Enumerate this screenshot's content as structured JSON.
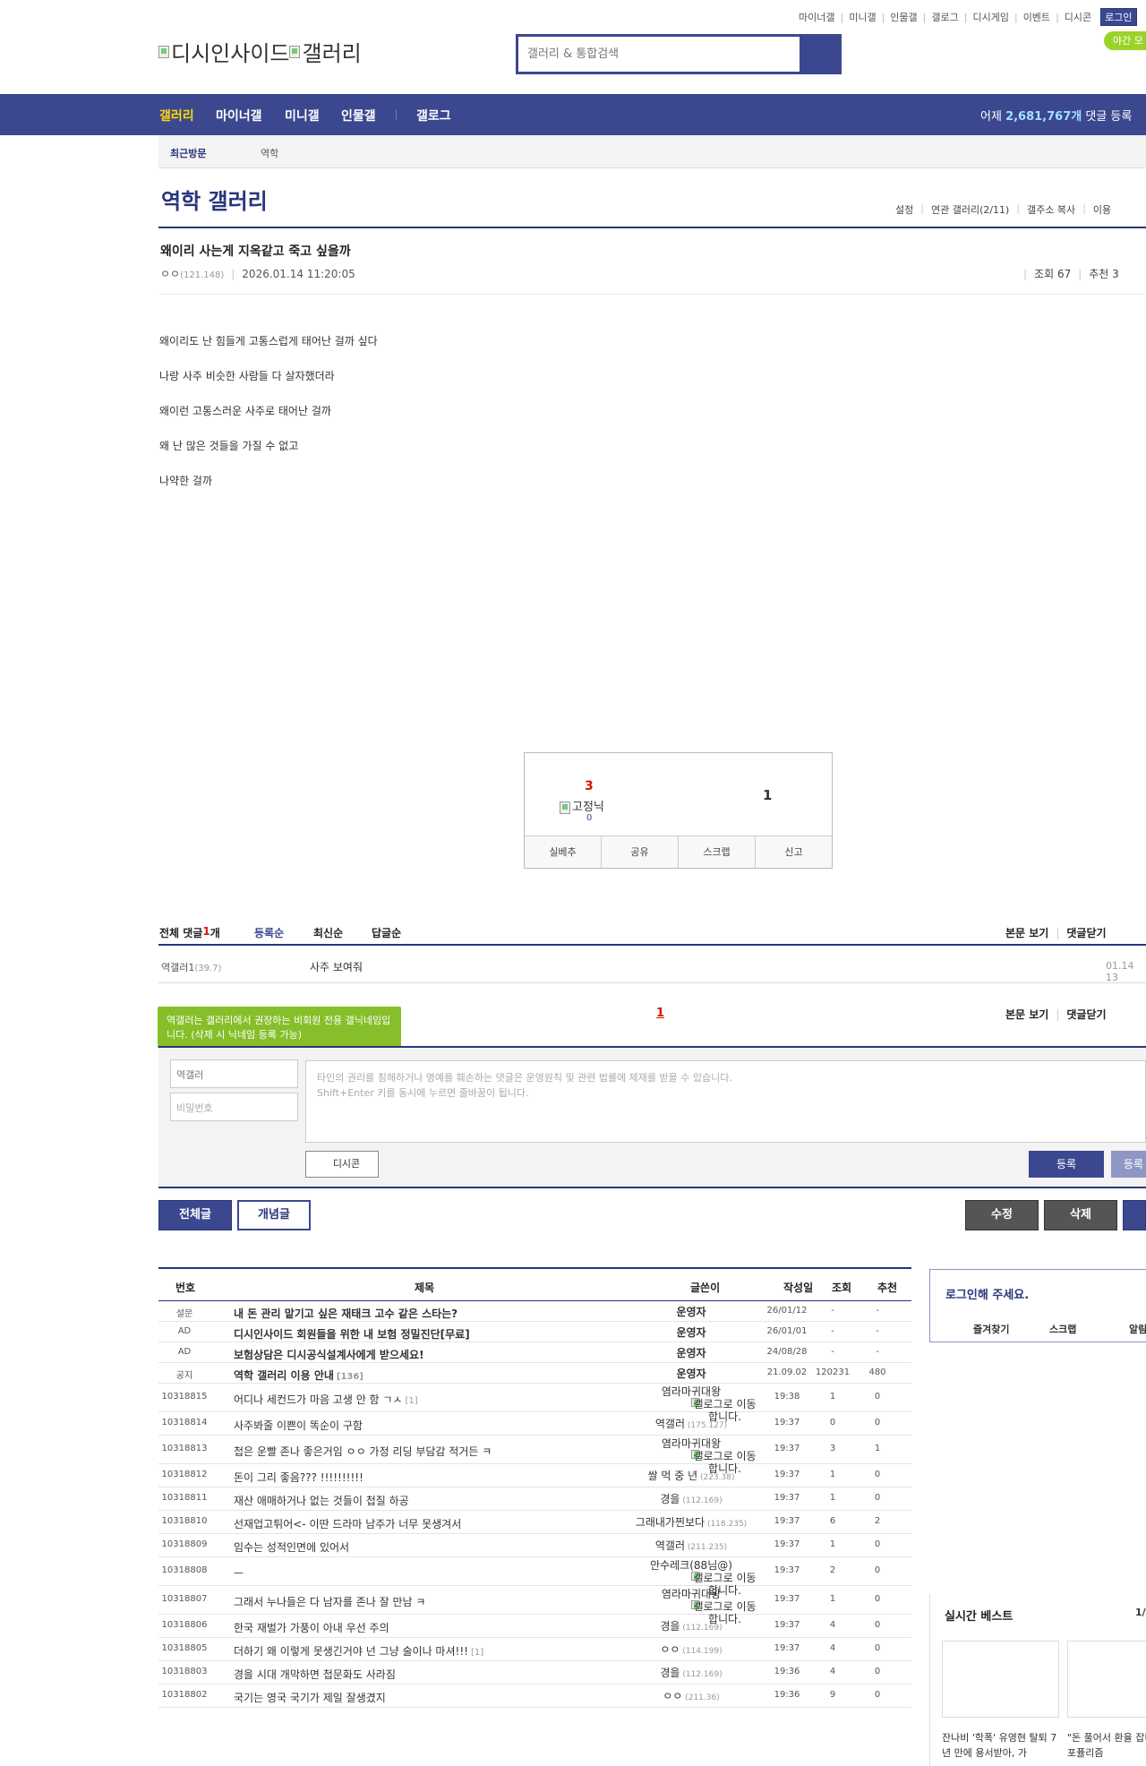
{
  "top_links": [
    "마이너갤",
    "미니갤",
    "인물갤",
    "갤로그",
    "디시게임",
    "이벤트",
    "디시콘"
  ],
  "login_label": "로그인",
  "night_label": "야간 모",
  "logo": {
    "text1": "디시인사이드",
    "text2": "갤러리"
  },
  "search": {
    "placeholder": "갤러리 & 통합검색"
  },
  "nav": {
    "items": [
      "갤러리",
      "마이너갤",
      "미니갤",
      "인물갤",
      "갤로그"
    ],
    "right_prefix": "어제 ",
    "right_count": "2,681,767개",
    "right_suffix": " 댓글 등록"
  },
  "recent": {
    "label": "최근방문",
    "item": "역학"
  },
  "gallery_title": "역학 갤러리",
  "gallery_tools": [
    "설정",
    "연관 갤러리(2/11)",
    "갤주소 복사",
    "이용"
  ],
  "post": {
    "title": "왜이리 사는게 지옥같고 죽고 싶을까",
    "author": "ㅇㅇ",
    "author_ip": "(121.148)",
    "date": "2026.01.14 11:20:05",
    "views_label": "조회 67",
    "recommend_label": "추천 3",
    "body": [
      "왜이리도 난 힘들게 고통스럽게 태어난 걸까 싶다",
      "나랑 사주 비슷한 사람들 다 살자했더라",
      "왜이런 고통스러운 사주로 태어난 걸까",
      "왜 난 많은 것들을 가질 수 없고",
      "나약한 걸까"
    ]
  },
  "recommend_box": {
    "up": "3",
    "fix_label": "고정닉",
    "fix_count": "0",
    "down": "1",
    "buttons": [
      "실베추",
      "공유",
      "스크랩",
      "신고"
    ]
  },
  "comments": {
    "total_label": "전체 댓글 ",
    "total_count": "1",
    "total_unit": "개",
    "sort": [
      "등록순",
      "최신순",
      "답글순"
    ],
    "right_links": [
      "본문 보기",
      "댓글닫기"
    ],
    "items": [
      {
        "author": "역갤러1",
        "ip": "(39.7)",
        "text": "사주 보여줘",
        "date": "01.14 13"
      }
    ],
    "page": "1",
    "tooltip": "역갤러는 갤러리에서 권장하는 비회원 전용 갤닉네임입니다. (삭제 시 닉네임 등록 가능)",
    "form": {
      "nickname": "역갤러",
      "password_placeholder": "비밀번호",
      "textarea_placeholder_1": "타인의 권리를 침해하거나 명예를 훼손하는 댓글은 운영원칙 및 관련 법률에 제재를 받을 수 있습니다.",
      "textarea_placeholder_2": "Shift+Enter 키를 동시에 누르면 줄바꿈이 됩니다.",
      "dccon_label": "디시콘",
      "submit_label": "등록",
      "submit2_label": "등록"
    }
  },
  "list_buttons": {
    "all": "전체글",
    "concept": "개념글",
    "edit": "수정",
    "delete": "삭제"
  },
  "list": {
    "headers": {
      "no": "번호",
      "title": "제목",
      "writer": "글쓴이",
      "date": "작성일",
      "views": "조회",
      "rec": "추천"
    },
    "rows": [
      {
        "no": "설문",
        "title": "내 돈 관리 맡기고 싶은 재태크 고수 같은 스타는?",
        "writer": "운영자",
        "ip": "",
        "date": "26/01/12",
        "views": "-",
        "rec": "-",
        "notice": true
      },
      {
        "no": "AD",
        "title": "디시인사이드 회원들을 위한 내 보험 정밀진단[무료]",
        "writer": "운영자",
        "ip": "",
        "date": "26/01/01",
        "views": "-",
        "rec": "-",
        "notice": true
      },
      {
        "no": "AD",
        "title": "보험상담은 디시공식설계사에게 받으세요!",
        "writer": "운영자",
        "ip": "",
        "date": "24/08/28",
        "views": "-",
        "rec": "-",
        "notice": true
      },
      {
        "no": "공지",
        "title": "역학 갤러리 이용 안내",
        "cnt": "[136]",
        "writer": "운영자",
        "ip": "",
        "date": "21.09.02",
        "views": "120231",
        "rec": "480",
        "notice": true
      },
      {
        "no": "10318815",
        "title": "어디나 세컨드가 마음 고생 안 함 ㄱㅅ",
        "cnt": "[1]",
        "writer": "염라마귀대왕",
        "glog": "갤로그로 이동합니다.",
        "date": "19:38",
        "views": "1",
        "rec": "0"
      },
      {
        "no": "10318814",
        "title": "사주봐줄 이쁜이 똑순이 구함",
        "writer": "역갤러",
        "ip": "(175.127)",
        "date": "19:37",
        "views": "0",
        "rec": "0"
      },
      {
        "no": "10318813",
        "title": "첩은 운빨 존나 좋은거임 ㅇㅇ 가정 리딩 부담감 적거든 ㅋ",
        "writer": "염라마귀대왕",
        "glog": "갤로그로 이동합니다.",
        "date": "19:37",
        "views": "3",
        "rec": "1"
      },
      {
        "no": "10318812",
        "title": "돈이 그리 좋음??? !!!!!!!!!!",
        "writer": "쌀 먹 중 년",
        "ip": "(223.38)",
        "date": "19:37",
        "views": "1",
        "rec": "0"
      },
      {
        "no": "10318811",
        "title": "재산 애매하거나 없는 것들이 첩질 하공",
        "writer": "경을",
        "ip": "(112.169)",
        "date": "19:37",
        "views": "1",
        "rec": "0"
      },
      {
        "no": "10318810",
        "title": "선재업고튀어<- 이딴 드라마 남주가 너무 못생겨서",
        "writer": "그래내가찐보다",
        "ip": "(118.235)",
        "date": "19:37",
        "views": "6",
        "rec": "2"
      },
      {
        "no": "10318809",
        "title": "임수는 성적인면에 있어서",
        "writer": "역갤러",
        "ip": "(211.235)",
        "date": "19:37",
        "views": "1",
        "rec": "0"
      },
      {
        "no": "10318808",
        "title": "ㅡ",
        "writer": "안수레크(88님@)",
        "glog": "갤로그로 이동합니다.",
        "date": "19:37",
        "views": "2",
        "rec": "0"
      },
      {
        "no": "10318807",
        "title": "그래서 누나들은 다 남자를 존나 잘 만남 ㅋ",
        "writer": "염라마귀대왕",
        "glog": "갤로그로 이동합니다.",
        "date": "19:37",
        "views": "1",
        "rec": "0"
      },
      {
        "no": "10318806",
        "title": "한국 재벌가 가풍이 아내 우선 주의",
        "writer": "경을",
        "ip": "(112.169)",
        "date": "19:37",
        "views": "4",
        "rec": "0"
      },
      {
        "no": "10318805",
        "title": "더하기 왜 이렇게 못생긴거야 넌 그냥 술이나 마셔!!!",
        "cnt": "[1]",
        "writer": "ㅇㅇ",
        "ip": "(114.199)",
        "date": "19:37",
        "views": "4",
        "rec": "0"
      },
      {
        "no": "10318803",
        "title": "경을 시대 개막하면 첩문화도 사라짐",
        "writer": "경을",
        "ip": "(112.169)",
        "date": "19:36",
        "views": "4",
        "rec": "0"
      },
      {
        "no": "10318802",
        "title": "국기는 영국 국기가 제일 잘생겼지",
        "writer": "ㅇㅇ",
        "ip": "(211.36)",
        "date": "19:36",
        "views": "9",
        "rec": "0"
      }
    ]
  },
  "side_login": {
    "title": "로그인해 주세요.",
    "links": [
      "즐겨찾기",
      "스크랩",
      "알림"
    ]
  },
  "best": {
    "title": "실시간 베스트",
    "page": "1/",
    "items": [
      {
        "caption": "잔나비 '학폭' 유영현 탈퇴 7년 만에 용서받아, 가"
      },
      {
        "caption": "\"돈 풀어서 환율 잡니거든\" 포퓰리즘"
      }
    ]
  }
}
